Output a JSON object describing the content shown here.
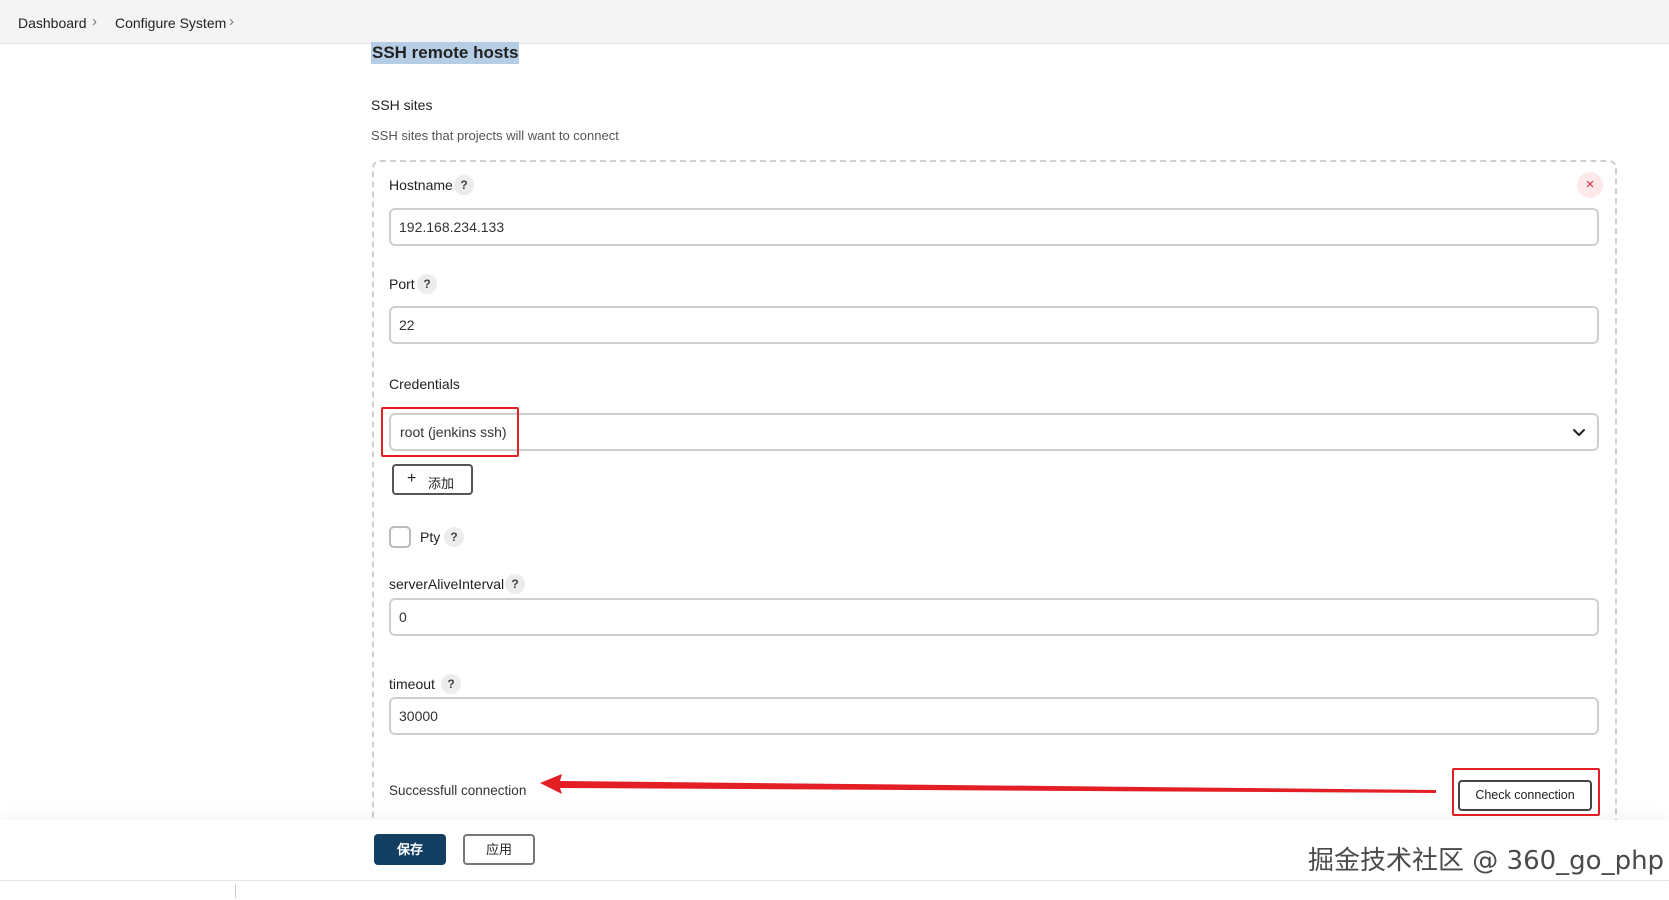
{
  "breadcrumb": {
    "items": [
      "Dashboard",
      "Configure System"
    ]
  },
  "section": {
    "title": "SSH remote hosts",
    "subtitle": "SSH sites",
    "description": "SSH sites that projects will want to connect"
  },
  "form": {
    "close_symbol": "×",
    "help_symbol": "?",
    "hostname": {
      "label": "Hostname",
      "value": "192.168.234.133"
    },
    "port": {
      "label": "Port",
      "value": "22"
    },
    "credentials": {
      "label": "Credentials",
      "selected": "root (jenkins ssh)",
      "add_label": "添加",
      "add_symbol": "+"
    },
    "pty": {
      "label": "Pty",
      "checked": false
    },
    "server_alive_interval": {
      "label": "serverAliveInterval",
      "value": "0"
    },
    "timeout": {
      "label": "timeout",
      "value": "30000"
    },
    "status_text": "Successfull connection",
    "check_button": "Check connection"
  },
  "footer": {
    "save_label": "保存",
    "apply_label": "应用",
    "primary_color": "#123f61"
  },
  "annotation_color": "#e31e24",
  "watermark": "掘金技术社区 @ 360_go_php",
  "icons": {
    "breadcrumb_separator": "chevron-right-icon",
    "select_dropdown": "chevron-down-icon",
    "remove_site": "close-icon"
  }
}
